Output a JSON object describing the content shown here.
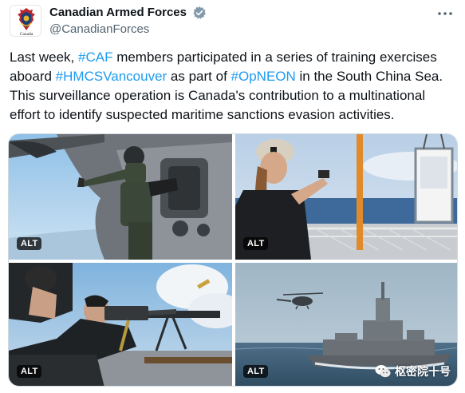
{
  "author": {
    "display_name": "Canadian Armed Forces",
    "handle": "@CanadianForces",
    "avatar_caption": "Canada",
    "verified_color": "#829aab"
  },
  "tweet": {
    "segments": [
      {
        "text": "Last week, ",
        "tag": false
      },
      {
        "text": "#CAF",
        "tag": true
      },
      {
        "text": " members participated in a series of training exercises aboard ",
        "tag": false
      },
      {
        "text": "#HMCSVancouver",
        "tag": true
      },
      {
        "text": " as part of ",
        "tag": false
      },
      {
        "text": "#OpNEON",
        "tag": true
      },
      {
        "text": " in the South China Sea. This surveillance operation is Canada's contribution to a multinational effort to identify suspected maritime sanctions evasion activities.",
        "tag": false
      }
    ]
  },
  "media": {
    "alt_label": "ALT",
    "watermark": "枢密院十号"
  },
  "colors": {
    "link": "#1d9bf0",
    "text": "#0f1419",
    "secondary": "#536471"
  }
}
